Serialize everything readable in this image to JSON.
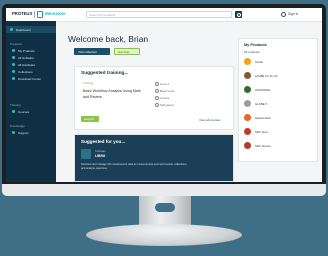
{
  "header": {
    "logo_text": "PROTEUS",
    "brand": "IREVISION",
    "search_placeholder": "Search for products",
    "sign_in": "Sign in"
  },
  "sidebar": {
    "items": [
      "Dashboard",
      "Products",
      "My Products",
      "All Software",
      "All Hardware",
      "Collections",
      "Download Center",
      "Training",
      "Courses",
      "Knowledge",
      "Support"
    ]
  },
  "main": {
    "welcome": "Welcome back, Brian",
    "btn_primary": "Visit collection",
    "btn_secondary": "Get help",
    "training": {
      "title": "Suggested training...",
      "tag": "Training",
      "course": "Basic Workflow Analysis Using Mark and Review",
      "meta": [
        "Level 1",
        "Basic Level",
        "2 hours",
        "Self-paced"
      ],
      "register": "Register",
      "view_all": "View all courses"
    },
    "suggested": {
      "title": "Suggested for you...",
      "small": "Software",
      "name": "LIBRA",
      "description": "Structure and manage 3D measurement data as measurement point and results, collections, and analyse outcomes"
    }
  },
  "products": {
    "title": "My Products",
    "all_label": "All products",
    "items": [
      {
        "name": "Scribe",
        "color": "#f0a31c"
      },
      {
        "name": "LAUBE CX-11-CS",
        "color": "#7b5a3c"
      },
      {
        "name": "ADVANCED",
        "color": "#2e6d2e"
      },
      {
        "name": "GLOBE 5",
        "color": "#9a9ea2"
      },
      {
        "name": "SpaceCheck",
        "color": "#e06a1c"
      },
      {
        "name": "SRC Spec",
        "color": "#c0392b"
      },
      {
        "name": "SRC Service",
        "color": "#b03a2e"
      }
    ]
  }
}
